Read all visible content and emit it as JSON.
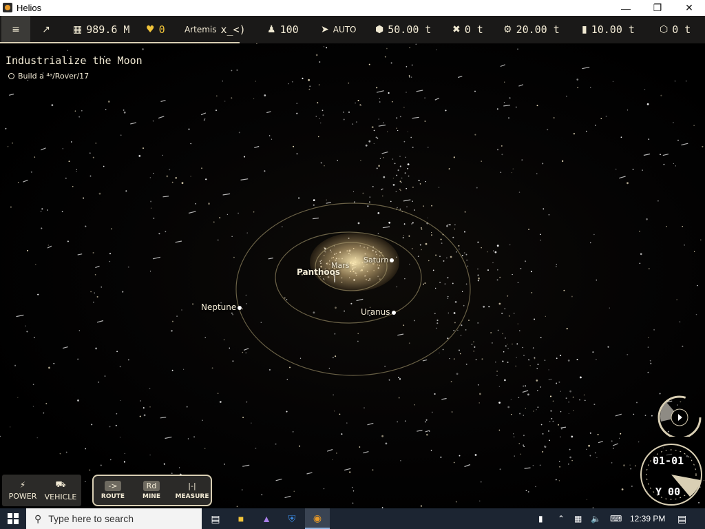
{
  "window": {
    "title": "Helios"
  },
  "hud": {
    "money": "989.6 M",
    "hearts": "0",
    "mission": "Artemis",
    "code": "x_<)",
    "population": "100",
    "launch_mode": "AUTO",
    "res1": "50.00 t",
    "res2": "0 t",
    "res3": "20.00 t",
    "res4": "10.00 t",
    "res5": "0 t",
    "progress_fraction": 0.34
  },
  "objective": {
    "title": "Industrialize the Moon",
    "item": "Build a ⁴ᵃ/Rover/17"
  },
  "map": {
    "labels": {
      "panthoos": "Panthoos",
      "neptune": "Neptune",
      "uranus": "Uranus",
      "saturn": "Saturn",
      "mars": "Mars"
    }
  },
  "tools": {
    "power": "POWER",
    "vehicle": "VEHICLE",
    "route": "ROUTE",
    "route_key": "->",
    "mine": "MINE",
    "mine_key": "Rd",
    "measure": "MEASURE",
    "measure_key": "|-|"
  },
  "clock": {
    "date": "01-01",
    "year": "Y 00"
  },
  "taskbar": {
    "search_placeholder": "Type here to search",
    "time": "12:39 PM"
  },
  "icons": {
    "menu": "list-icon",
    "chart": "chart-icon",
    "heart": "heart-icon",
    "person": "person-icon",
    "rocket": "rocket-icon",
    "cube": "cube-icon",
    "x-res": "cross-icon",
    "gear": "gear-icon",
    "panel": "panel-icon",
    "hex": "hex-icon"
  }
}
